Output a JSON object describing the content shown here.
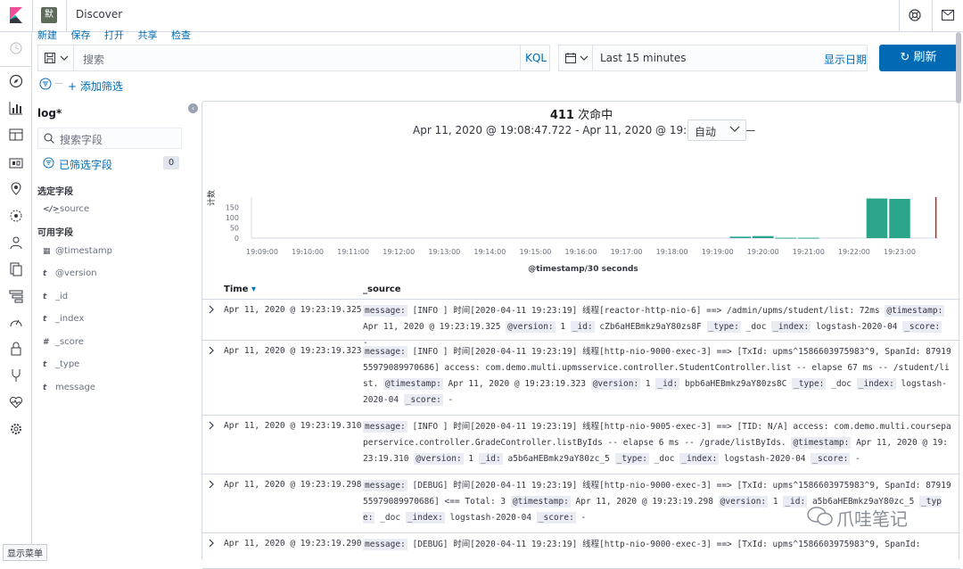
{
  "header": {
    "space_avatar": "默",
    "app_title": "Discover"
  },
  "topmenu": [
    "新建",
    "保存",
    "打开",
    "共享",
    "检查"
  ],
  "query": {
    "placeholder": "搜索",
    "language": "KQL"
  },
  "datepicker": {
    "range": "Last 15 minutes",
    "show_dates": "显示日期"
  },
  "refresh_label": "刷新",
  "filter": {
    "add_label": "+ 添加筛选"
  },
  "sidebar": {
    "index_pattern": "log*",
    "search_placeholder": "搜索字段",
    "filtered_label": "已筛选字段",
    "filtered_count": "0",
    "selected_header": "选定字段",
    "available_header": "可用字段",
    "selected_fields": [
      {
        "type": "</>",
        "name": "_source"
      }
    ],
    "available_fields": [
      {
        "type": "▦",
        "name": "@timestamp"
      },
      {
        "type": "t",
        "name": "@version"
      },
      {
        "type": "t",
        "name": "_id"
      },
      {
        "type": "t",
        "name": "_index"
      },
      {
        "type": "#",
        "name": "_score"
      },
      {
        "type": "t",
        "name": "_type"
      },
      {
        "type": "t",
        "name": "message"
      }
    ]
  },
  "results": {
    "hits": "411",
    "hits_label": "次命中",
    "time_range": "Apr 11, 2020 @ 19:08:47.722 - Apr 11, 2020 @ 19:23:47.722 —",
    "interval": "自动"
  },
  "chart_data": {
    "type": "bar",
    "xlabel": "@timestamp/30 seconds",
    "ylabel": "计数",
    "ylim": [
      0,
      190
    ],
    "yticks": [
      0,
      50,
      100,
      150
    ],
    "xticks": [
      "19:09:00",
      "19:10:00",
      "19:11:00",
      "19:12:00",
      "19:13:00",
      "19:14:00",
      "19:15:00",
      "19:16:00",
      "19:17:00",
      "19:18:00",
      "19:19:00",
      "19:20:00",
      "19:21:00",
      "19:22:00",
      "19:23:00"
    ],
    "bars": [
      {
        "t": "19:19:30",
        "value": 7
      },
      {
        "t": "19:20:00",
        "value": 10
      },
      {
        "t": "19:20:30",
        "value": 2
      },
      {
        "t": "19:21:00",
        "value": 2
      },
      {
        "t": "19:22:30",
        "value": 192
      },
      {
        "t": "19:23:00",
        "value": 190
      }
    ],
    "color": "#2aa58b",
    "now_marker": "19:23:47.722",
    "now_color": "#bd271e"
  },
  "table": {
    "col_time": "Time",
    "col_source": "_source",
    "rows": [
      {
        "time": "Apr 11, 2020 @ 19:23:19.325",
        "fields": [
          [
            "message:",
            "[INFO ] 时间[2020-04-11 19:23:19] 线程[reactor-http-nio-6] ==> /admin/upms/student/list: 72ms"
          ],
          [
            "@timestamp:",
            "Apr 11, 2020 @ 19:23:19.325"
          ],
          [
            "@version:",
            "1"
          ],
          [
            "_id:",
            "cZb6aHEBmkz9aY80zs8F"
          ],
          [
            "_type:",
            "_doc"
          ],
          [
            "_index:",
            "logstash-2020-04"
          ],
          [
            "_score:",
            "-"
          ]
        ]
      },
      {
        "time": "Apr 11, 2020 @ 19:23:19.323",
        "fields": [
          [
            "message:",
            "[INFO ] 时间[2020-04-11 19:23:19] 线程[http-nio-9000-exec-3] ==> [TxId: upms^1586603975983^9, SpanId: 8791955979089970686] access: com.demo.multi.upmsservice.controller.StudentController.list -- elapse 67 ms -- /student/list."
          ],
          [
            "@timestamp:",
            "Apr 11, 2020 @ 19:23:19.323"
          ],
          [
            "@version:",
            "1"
          ],
          [
            "_id:",
            "bpb6aHEBmkz9aY80zs8C"
          ],
          [
            "_type:",
            "_doc"
          ],
          [
            "_index:",
            "logstash-2020-04"
          ],
          [
            "_score:",
            "-"
          ]
        ]
      },
      {
        "time": "Apr 11, 2020 @ 19:23:19.310",
        "fields": [
          [
            "message:",
            "[INFO ] 时间[2020-04-11 19:23:19] 线程[http-nio-9005-exec-3] ==> [TID: N/A] access: com.demo.multi.coursepaperservice.controller.GradeController.listByIds -- elapse 6 ms -- /grade/listByIds."
          ],
          [
            "@timestamp:",
            "Apr 11, 2020 @ 19:23:19.310"
          ],
          [
            "@version:",
            "1"
          ],
          [
            "_id:",
            "a5b6aHEBmkz9aY80zc_5"
          ],
          [
            "_type:",
            "_doc"
          ],
          [
            "_index:",
            "logstash-2020-04"
          ],
          [
            "_score:",
            "-"
          ]
        ]
      },
      {
        "time": "Apr 11, 2020 @ 19:23:19.298",
        "fields": [
          [
            "message:",
            "[DEBUG] 时间[2020-04-11 19:23:19] 线程[http-nio-9000-exec-3] ==> [TxId: upms^1586603975983^9, SpanId: 8791955979089970686] <== Total: 3"
          ],
          [
            "@timestamp:",
            "Apr 11, 2020 @ 19:23:19.298"
          ],
          [
            "@version:",
            "1"
          ],
          [
            "_id:",
            "a5b6aHEBmkz9aY80zc_5"
          ],
          [
            "_type:",
            "_doc"
          ],
          [
            "_index:",
            "logstash-2020-04"
          ],
          [
            "_score:",
            "-"
          ]
        ]
      },
      {
        "time": "Apr 11, 2020 @ 19:23:19.290",
        "fields": [
          [
            "message:",
            "[DEBUG] 时间[2020-04-11 19:23:19] 线程[http-nio-9000-exec-3] ==> [TxId: upms^1586603975983^9, SpanId:"
          ]
        ]
      }
    ]
  },
  "bottom": {
    "show_menu": "显示菜单",
    "watermark": "爪哇笔记"
  }
}
